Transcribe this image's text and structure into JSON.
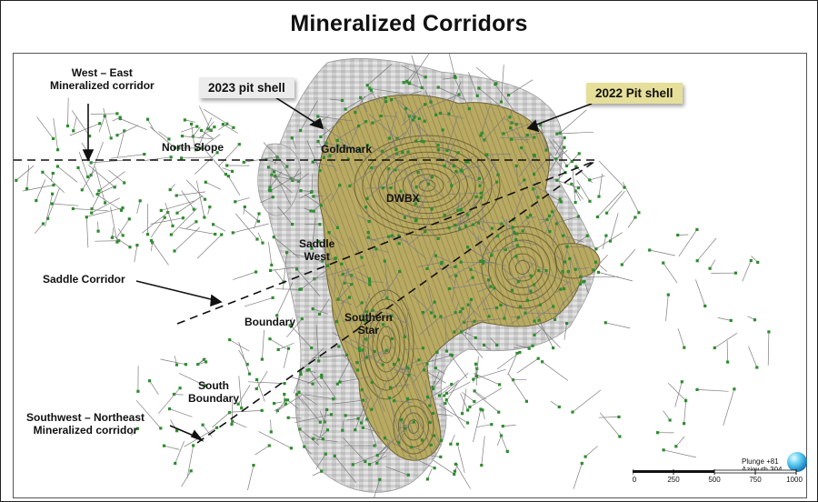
{
  "title": "Mineralized Corridors",
  "labels": {
    "west_east_line1": "West – East",
    "west_east_line2": "Mineralized corridor",
    "north_slope": "North Slope",
    "goldmark": "Goldmark",
    "dwbx": "DWBX",
    "saddle_west_line1": "Saddle",
    "saddle_west_line2": "West",
    "saddle_corridor": "Saddle Corridor",
    "boundary": "Boundary",
    "southern_star_line1": "Southern",
    "southern_star_line2": "Star",
    "south_boundary_line1": "South",
    "south_boundary_line2": "Boundary",
    "sw_ne_line1": "Southwest – Northeast",
    "sw_ne_line2": "Mineralized corridor"
  },
  "legend_boxes": {
    "pit_2023": "2023 pit shell",
    "pit_2022": "2022  Pit shell"
  },
  "orientation": {
    "plunge": "Plunge +81",
    "azimuth": "Azimuth 304"
  },
  "scale_bar": {
    "ticks": [
      "0",
      "250",
      "500",
      "750",
      "1000"
    ]
  },
  "colors": {
    "pit_2022_fill": "#b7a862",
    "pit_2023_fill": "#d2d2d2",
    "drill_collar": "#2e8b2e",
    "corridor_line": "#111111"
  }
}
